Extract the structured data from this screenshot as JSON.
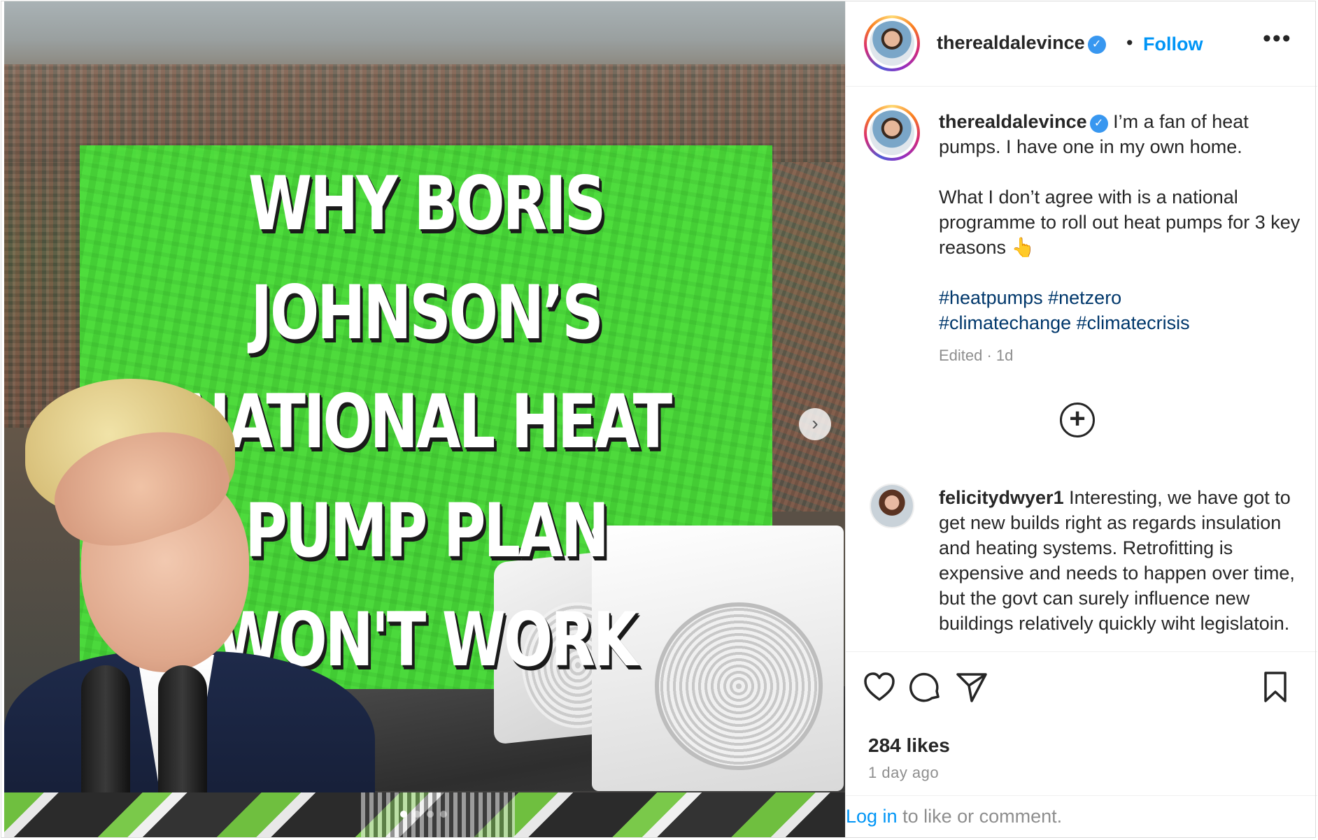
{
  "post": {
    "image": {
      "headline_lines": [
        "WHY BORIS",
        "JOHNSON’S",
        "NATIONAL HEAT",
        "PUMP PLAN",
        "WON'T WORK"
      ],
      "carousel": {
        "total": 4,
        "current": 1
      },
      "next_icon": "›"
    },
    "header": {
      "username": "therealdalevince",
      "verified_icon": "✓",
      "separator": "•",
      "follow_label": "Follow",
      "more_icon": "•••"
    },
    "caption": {
      "username": "therealdalevince",
      "verified_icon": "✓",
      "paragraph1": "I’m a fan of heat pumps. I have one in my own home.",
      "paragraph2": "What I don’t agree with is a national programme to roll out heat pumps for 3 key reasons 👆",
      "hashtags": [
        "#heatpumps",
        "#netzero",
        "#climatechange",
        "#climatecrisis"
      ],
      "meta": "Edited · 1d"
    },
    "load_more_icon": "+",
    "comment": {
      "username": "felicitydwyer1",
      "text": "Interesting, we have got to get new builds right as regards insulation and heating systems. Retrofitting is expensive and needs to happen over time, but the govt can surely influence new buildings relatively quickly wiht legislatoin."
    },
    "actions": {
      "icons": [
        "heart-icon",
        "comment-icon",
        "share-icon",
        "bookmark-icon"
      ]
    },
    "likes": "284 likes",
    "time_ago": "1 day ago",
    "login": {
      "link": "Log in",
      "rest": " to like or comment."
    }
  },
  "colors": {
    "accent": "#0095f6",
    "hashtag": "#00376b",
    "verified": "#3897f0",
    "green_overlay": "#48eb38",
    "muted_text": "#8e8e8e"
  }
}
